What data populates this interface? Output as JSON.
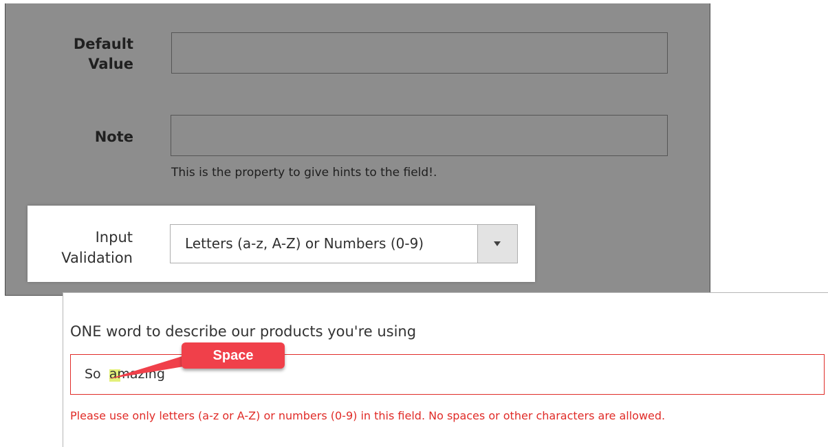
{
  "admin_form": {
    "default_value_label": "Default\nValue",
    "default_value_input": "",
    "note_label": "Note",
    "note_input": "",
    "note_hint": "This is the property to give hints to the field!.",
    "input_validation_label": "Input\nValidation",
    "input_validation_selected": "Letters (a-z, A-Z) or Numbers (0-9)"
  },
  "frontend_field": {
    "question": "ONE word to describe our products you're using",
    "answer_value": "So  amazing",
    "error_message": "Please use only letters (a-z or A-Z) or numbers (0-9) in this field. No spaces or other characters are allowed."
  },
  "annotation": {
    "label": "Space"
  },
  "colors": {
    "overlay": "#8d8d8d",
    "error": "#e02b27",
    "callout": "#f0404a",
    "space_highlight": "#e3f07a"
  },
  "icons": {
    "select_arrow": "chevron-down-icon"
  }
}
